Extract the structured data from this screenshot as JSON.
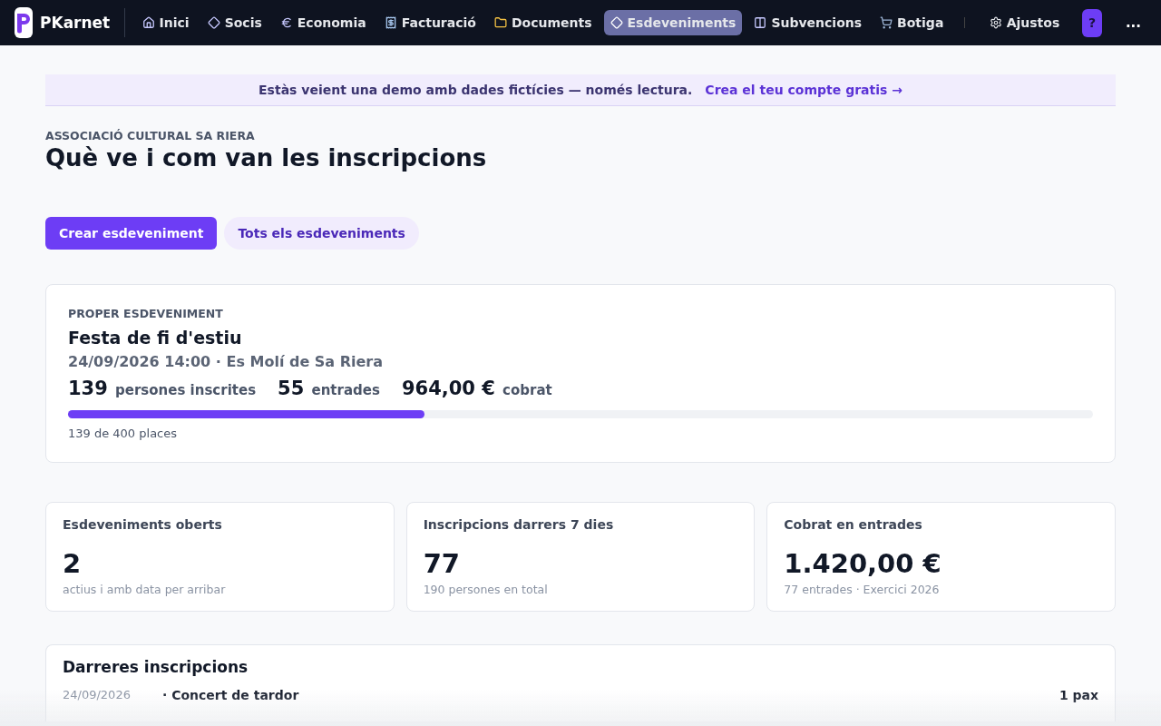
{
  "brand": {
    "name": "PKarnet"
  },
  "nav": [
    {
      "label": "Inici",
      "selected": false
    },
    {
      "label": "Socis",
      "selected": false
    },
    {
      "label": "Economia",
      "selected": false
    },
    {
      "label": "Facturació",
      "selected": false
    },
    {
      "label": "Documents",
      "selected": false
    },
    {
      "label": "Esdeveniments",
      "selected": true
    },
    {
      "label": "Subvencions",
      "selected": false
    },
    {
      "label": "Botiga",
      "selected": false
    }
  ],
  "settings": {
    "label": "Ajustos"
  },
  "help_button": "?",
  "more_button": "...",
  "banner": {
    "text": "Estàs veient una demo amb dades fictícies — només lectura.",
    "link": "Crea el teu compte gratis →"
  },
  "header": {
    "org": "ASSOCIACIÓ CULTURAL SA RIERA",
    "title": "Què ve i com van les inscripcions"
  },
  "actions": [
    {
      "label": "Crear esdeveniment",
      "kind": "primary"
    },
    {
      "label": "Tots els esdeveniments",
      "kind": "secondary"
    }
  ],
  "next_event": {
    "eyebrow": "PROPER ESDEVENIMENT",
    "title": "Festa de fi d'estiu",
    "when": "24/09/2026 14:00 · Es Molí de Sa Riera",
    "metrics": [
      "**139** persones inscrites",
      "**55** entrades",
      "**964,00 €** cobrat"
    ],
    "capacity": {
      "level": 0.3475,
      "caption": "139 de 400 places"
    }
  },
  "stats": [
    {
      "title": "Esdeveniments oberts",
      "value": "2",
      "note": "actius i amb data per arribar"
    },
    {
      "title": "Inscripcions darrers 7 dies",
      "value": "77",
      "note": "190 persones en total"
    },
    {
      "title": "Cobrat en entrades",
      "value": "1.420,00 €",
      "note": "77 entrades · Exercici 2026"
    }
  ],
  "recent": {
    "title": "Darreres inscripcions",
    "rows": [
      {
        "date": "24/09/2026",
        "event": "· Concert de tardor",
        "count": "1 pax"
      }
    ]
  }
}
